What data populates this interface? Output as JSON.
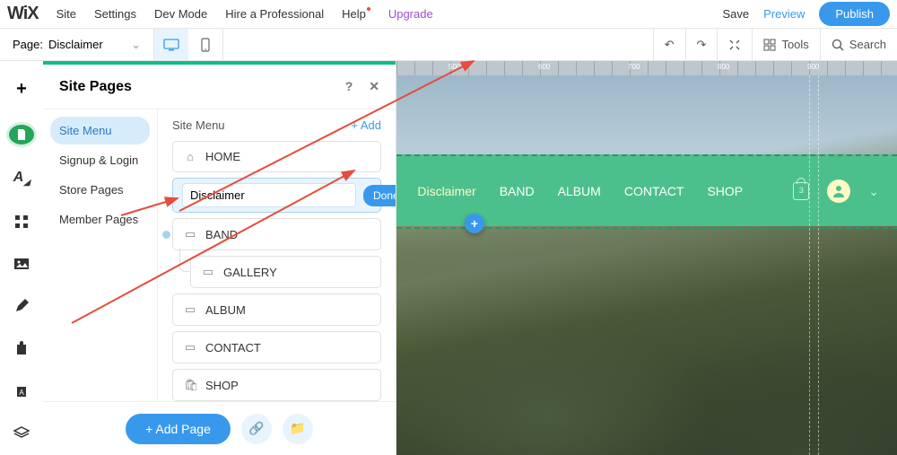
{
  "top": {
    "site": "Site",
    "settings": "Settings",
    "devmode": "Dev Mode",
    "hire": "Hire a Professional",
    "help": "Help",
    "upgrade": "Upgrade",
    "save": "Save",
    "preview": "Preview",
    "publish": "Publish"
  },
  "pagebar": {
    "label": "Page:",
    "page": "Disclaimer",
    "tools": "Tools",
    "search": "Search"
  },
  "panel": {
    "title": "Site Pages",
    "help": "?",
    "cats": [
      "Site Menu",
      "Signup & Login",
      "Store Pages",
      "Member Pages"
    ],
    "subtitle": "Site Menu",
    "addlink": "+ Add",
    "pages": {
      "home": "HOME",
      "disclaimer": "Disclaimer",
      "done": "Done",
      "band": "BAND",
      "gallery": "GALLERY",
      "album": "ALBUM",
      "contact": "CONTACT",
      "shop": "SHOP"
    },
    "addpage": "+ Add Page"
  },
  "nav": {
    "items": [
      "Disclaimer",
      "BAND",
      "ALBUM",
      "CONTACT",
      "SHOP"
    ],
    "cart": "3"
  },
  "ruler": {
    "a": "500",
    "b": "600",
    "c": "700",
    "d": "800",
    "e": "900"
  }
}
